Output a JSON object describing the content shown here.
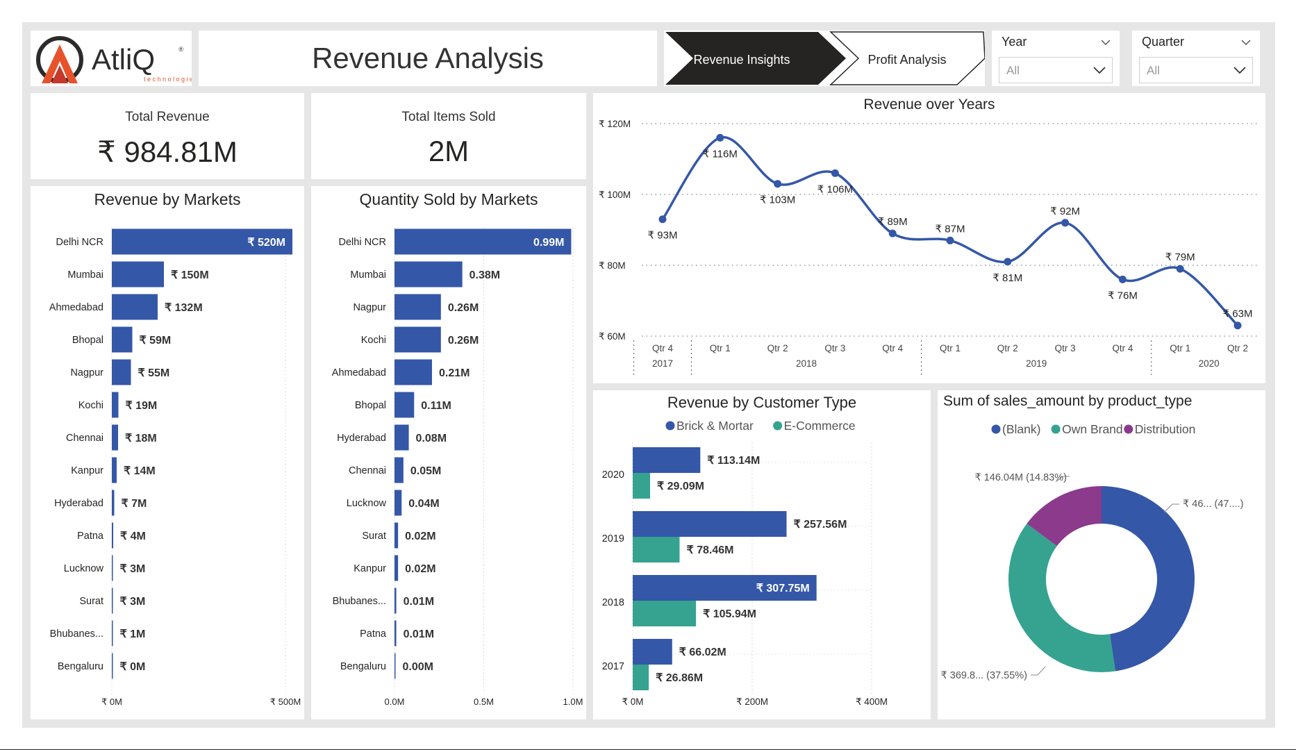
{
  "header": {
    "logo_text": "AtliQ",
    "logo_sub": "technologies",
    "title": "Revenue Analysis",
    "tab_active": "Revenue Insights",
    "tab_other": "Profit Analysis"
  },
  "filters": {
    "year": {
      "label": "Year",
      "value": "All"
    },
    "quarter": {
      "label": "Quarter",
      "value": "All"
    }
  },
  "cards": {
    "total_revenue": {
      "label": "Total Revenue",
      "value": "₹ 984.81M"
    },
    "total_items": {
      "label": "Total Items Sold",
      "value": "2M"
    }
  },
  "colors": {
    "blue": "#3457a8",
    "teal": "#35a38f",
    "purple": "#8b3a8c"
  },
  "chart_data": [
    {
      "type": "bar",
      "title": "Revenue by Markets",
      "orientation": "horizontal",
      "categories": [
        "Delhi NCR",
        "Mumbai",
        "Ahmedabad",
        "Bhopal",
        "Nagpur",
        "Kochi",
        "Chennai",
        "Kanpur",
        "Hyderabad",
        "Patna",
        "Lucknow",
        "Surat",
        "Bhubanes...",
        "Bengaluru"
      ],
      "values": [
        520,
        150,
        132,
        59,
        55,
        19,
        18,
        14,
        7,
        4,
        3,
        3,
        1,
        0
      ],
      "labels": [
        "₹ 520M",
        "₹ 150M",
        "₹ 132M",
        "₹ 59M",
        "₹ 55M",
        "₹ 19M",
        "₹ 18M",
        "₹ 14M",
        "₹ 7M",
        "₹ 4M",
        "₹ 3M",
        "₹ 3M",
        "₹ 1M",
        "₹ 0M"
      ],
      "xlim": [
        0,
        500
      ],
      "ticks": [
        {
          "v": 0,
          "label": "₹ 0M"
        },
        {
          "v": 500,
          "label": "₹ 500M"
        }
      ]
    },
    {
      "type": "bar",
      "title": "Quantity Sold by Markets",
      "orientation": "horizontal",
      "categories": [
        "Delhi NCR",
        "Mumbai",
        "Nagpur",
        "Kochi",
        "Ahmedabad",
        "Bhopal",
        "Hyderabad",
        "Chennai",
        "Lucknow",
        "Surat",
        "Kanpur",
        "Bhubanes...",
        "Patna",
        "Bengaluru"
      ],
      "values": [
        0.99,
        0.38,
        0.26,
        0.26,
        0.21,
        0.11,
        0.08,
        0.05,
        0.04,
        0.02,
        0.02,
        0.01,
        0.01,
        0.0
      ],
      "labels": [
        "0.99M",
        "0.38M",
        "0.26M",
        "0.26M",
        "0.21M",
        "0.11M",
        "0.08M",
        "0.05M",
        "0.04M",
        "0.02M",
        "0.02M",
        "0.01M",
        "0.01M",
        "0.00M"
      ],
      "xlim": [
        0,
        1.0
      ],
      "ticks": [
        {
          "v": 0,
          "label": "0.0M"
        },
        {
          "v": 0.5,
          "label": "0.5M"
        },
        {
          "v": 1.0,
          "label": "1.0M"
        }
      ]
    },
    {
      "type": "line",
      "title": "Revenue over Years",
      "x": [
        "Qtr 4",
        "Qtr 1",
        "Qtr 2",
        "Qtr 3",
        "Qtr 4",
        "Qtr 1",
        "Qtr 2",
        "Qtr 3",
        "Qtr 4",
        "Qtr 1",
        "Qtr 2"
      ],
      "years": [
        {
          "label": "2017",
          "from": 0,
          "to": 0
        },
        {
          "label": "2018",
          "from": 1,
          "to": 4
        },
        {
          "label": "2019",
          "from": 5,
          "to": 8
        },
        {
          "label": "2020",
          "from": 9,
          "to": 10
        }
      ],
      "values": [
        93,
        116,
        103,
        106,
        89,
        87,
        81,
        92,
        76,
        79,
        63
      ],
      "labels": [
        "₹ 93M",
        "₹ 116M",
        "₹ 103M",
        "₹ 106M",
        "₹ 89M",
        "₹ 87M",
        "₹ 81M",
        "₹ 92M",
        "₹ 76M",
        "₹ 79M",
        "₹ 63M"
      ],
      "label_pos": [
        "below",
        "below",
        "below",
        "below",
        "above",
        "above",
        "below",
        "above",
        "below",
        "above",
        "above"
      ],
      "ylim": [
        60,
        120
      ],
      "yticks": [
        {
          "v": 120,
          "label": "₹ 120M"
        },
        {
          "v": 100,
          "label": "₹ 100M"
        },
        {
          "v": 80,
          "label": "₹ 80M"
        },
        {
          "v": 60,
          "label": "₹ 60M"
        }
      ]
    },
    {
      "type": "bar",
      "title": "Revenue by Customer Type",
      "orientation": "horizontal",
      "categories": [
        "2020",
        "2019",
        "2018",
        "2017"
      ],
      "series": [
        {
          "name": "Brick & Mortar",
          "values": [
            113.14,
            257.56,
            307.75,
            66.02
          ],
          "labels": [
            "₹ 113.14M",
            "₹ 257.56M",
            "₹ 307.75M",
            "₹ 66.02M"
          ]
        },
        {
          "name": "E-Commerce",
          "values": [
            29.09,
            78.46,
            105.94,
            26.86
          ],
          "labels": [
            "₹ 29.09M",
            "₹ 78.46M",
            "₹ 105.94M",
            "₹ 26.86M"
          ]
        }
      ],
      "xlim": [
        0,
        400
      ],
      "ticks": [
        {
          "v": 0,
          "label": "₹ 0M"
        },
        {
          "v": 200,
          "label": "₹ 200M"
        },
        {
          "v": 400,
          "label": "₹ 400M"
        }
      ],
      "legend_position": "top"
    },
    {
      "type": "pie",
      "title": "Sum of sales_amount by product_type",
      "donut": true,
      "slices": [
        {
          "name": "(Blank)",
          "percent": 47.62,
          "label": "₹ 46... (47....)"
        },
        {
          "name": "Own Brand",
          "percent": 37.55,
          "label": "₹ 369.8... (37.55%)"
        },
        {
          "name": "Distribution",
          "percent": 14.83,
          "label": "₹ 146.04M (14.83%)"
        }
      ],
      "legend_position": "top"
    }
  ]
}
